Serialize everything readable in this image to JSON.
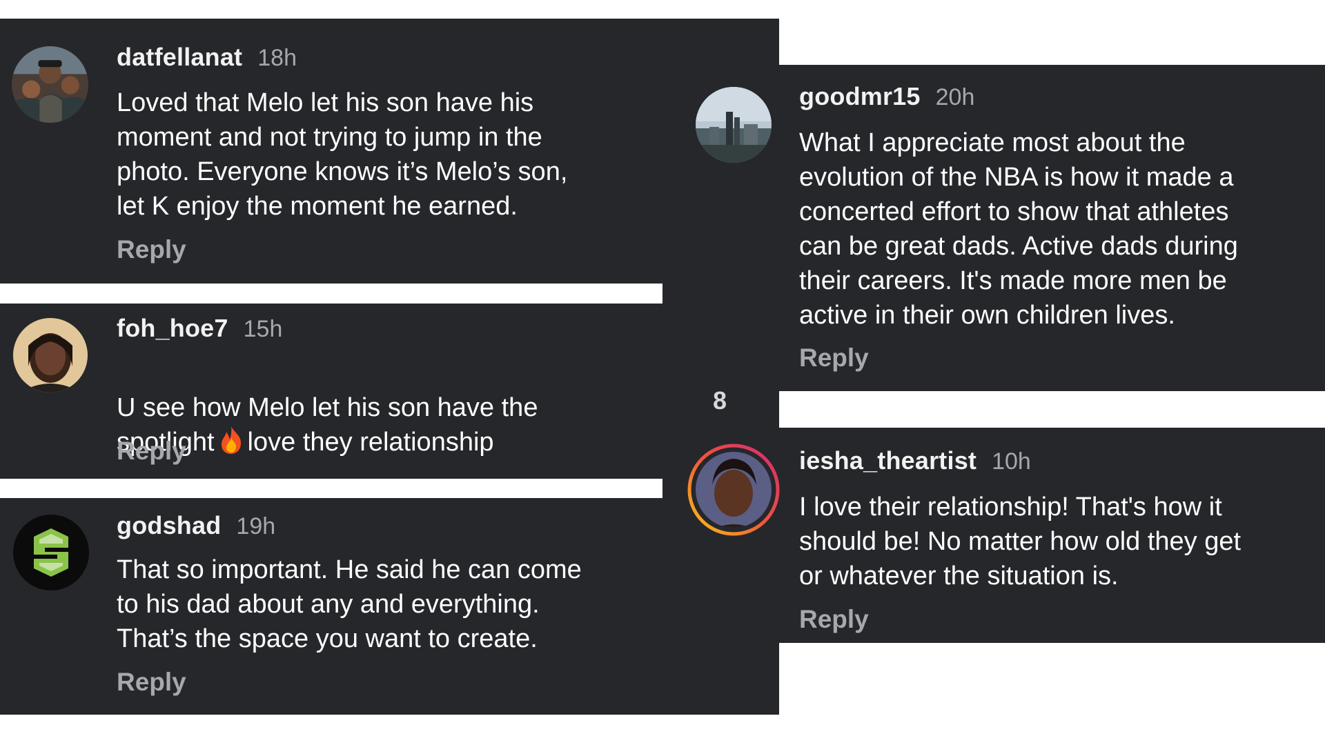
{
  "left_column": {
    "comments": [
      {
        "username": "datfellanat",
        "time": "18h",
        "text": "Loved that Melo let his son have his\nmoment and not trying to jump in the\nphoto. Everyone knows it’s Melo’s son,\nlet K enjoy the moment he earned.",
        "reply_label": "Reply",
        "avatar": "family-photo-avatar"
      },
      {
        "username": "foh_hoe7",
        "time": "15h",
        "text_before_emoji": "U see how Melo let his son have the\nspotlight",
        "emoji": "fire-emoji",
        "text_after_emoji": "love they relationship",
        "reply_label": "Reply",
        "avatar": "selfie-avatar"
      },
      {
        "username": "godshad",
        "time": "19h",
        "text": "That so important. He said he can come\nto his dad about any and everything.\nThat’s the space you want to create.",
        "reply_label": "Reply",
        "avatar": "green-s-logo-avatar"
      }
    ]
  },
  "right_column": {
    "comments": [
      {
        "username": "goodmr15",
        "time": "20h",
        "text": "What I appreciate most about the\nevolution of the NBA is how it made a\nconcerted effort to show that athletes\ncan be great dads. Active dads during\ntheir careers.  It's made more men be\nactive in their own children lives.",
        "reply_label": "Reply",
        "avatar": "city-skyline-avatar"
      },
      {
        "username": "iesha_theartist",
        "time": "10h",
        "text": "I love their relationship! That's how it\nshould be! No matter how old they get\nor whatever the situation is.",
        "reply_label": "Reply",
        "avatar": "portrait-story-ring-avatar"
      }
    ],
    "like_count": "8"
  },
  "colors": {
    "panel_bg": "#26272b",
    "page_bg": "#ffffff",
    "muted_text": "#a7a8ac",
    "story_ring_start": "#f5c518",
    "story_ring_end": "#d62976"
  }
}
